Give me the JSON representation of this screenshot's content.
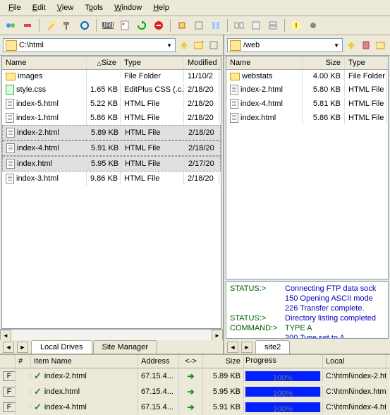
{
  "menu": {
    "items": [
      "File",
      "Edit",
      "View",
      "Tools",
      "Window",
      "Help"
    ]
  },
  "local": {
    "path": "C:\\html",
    "columns": [
      "Name",
      "Size",
      "Type",
      "Modified"
    ],
    "files": [
      {
        "icon": "folder",
        "name": "images",
        "size": "",
        "type": "File Folder",
        "mod": "11/10/2"
      },
      {
        "icon": "css",
        "name": "style.css",
        "size": "1.65 KB",
        "type": "EditPlus CSS (.c...",
        "mod": "2/18/20"
      },
      {
        "icon": "file",
        "name": "index-5.html",
        "size": "5.22 KB",
        "type": "HTML File",
        "mod": "2/18/20"
      },
      {
        "icon": "file",
        "name": "index-1.html",
        "size": "5.86 KB",
        "type": "HTML File",
        "mod": "2/18/20"
      },
      {
        "icon": "file",
        "name": "index-2.html",
        "size": "5.89 KB",
        "type": "HTML File",
        "mod": "2/18/20",
        "sel": true
      },
      {
        "icon": "file",
        "name": "index-4.html",
        "size": "5.91 KB",
        "type": "HTML File",
        "mod": "2/18/20",
        "sel": true
      },
      {
        "icon": "file",
        "name": "index.html",
        "size": "5.95 KB",
        "type": "HTML File",
        "mod": "2/17/20",
        "sel": true
      },
      {
        "icon": "file",
        "name": "index-3.html",
        "size": "9.86 KB",
        "type": "HTML File",
        "mod": "2/18/20"
      }
    ]
  },
  "remote": {
    "path": "/web",
    "columns": [
      "Name",
      "Size",
      "Type"
    ],
    "files": [
      {
        "icon": "folder",
        "name": "webstats",
        "size": "4.00 KB",
        "type": "File Folder"
      },
      {
        "icon": "file",
        "name": "index-2.html",
        "size": "5.80 KB",
        "type": "HTML File"
      },
      {
        "icon": "file",
        "name": "index-4.html",
        "size": "5.81 KB",
        "type": "HTML File"
      },
      {
        "icon": "file",
        "name": "index.html",
        "size": "5.86 KB",
        "type": "HTML File"
      }
    ]
  },
  "log": [
    {
      "label": "STATUS:>",
      "msg": "Connecting FTP data sock"
    },
    {
      "label": "",
      "msg": "150 Opening ASCII mode"
    },
    {
      "label": "",
      "msg": "226 Transfer complete."
    },
    {
      "label": "STATUS:>",
      "msg": "Directory listing completed"
    },
    {
      "label": "COMMAND:>",
      "msg": "TYPE A",
      "cmd": true
    },
    {
      "label": "",
      "msg": "200 Type set to A"
    }
  ],
  "tabs": {
    "left": [
      "Local Drives",
      "Site Manager"
    ],
    "right": [
      "site2"
    ]
  },
  "transfer": {
    "columns": [
      "",
      "#",
      "Item Name",
      "Address",
      "<->",
      "Size",
      "Progress",
      "Local"
    ],
    "rows": [
      {
        "f": "F",
        "name": "index-2.html",
        "addr": "67.15.4...",
        "size": "5.89 KB",
        "prog": "100%",
        "local": "C:\\html\\index-2.ht"
      },
      {
        "f": "F",
        "name": "index.html",
        "addr": "67.15.4...",
        "size": "5.95 KB",
        "prog": "100%",
        "local": "C:\\html\\index.htm"
      },
      {
        "f": "F",
        "name": "index-4.html",
        "addr": "67.15.4...",
        "size": "5.91 KB",
        "prog": "100%",
        "local": "C:\\html\\index-4.ht"
      }
    ]
  }
}
